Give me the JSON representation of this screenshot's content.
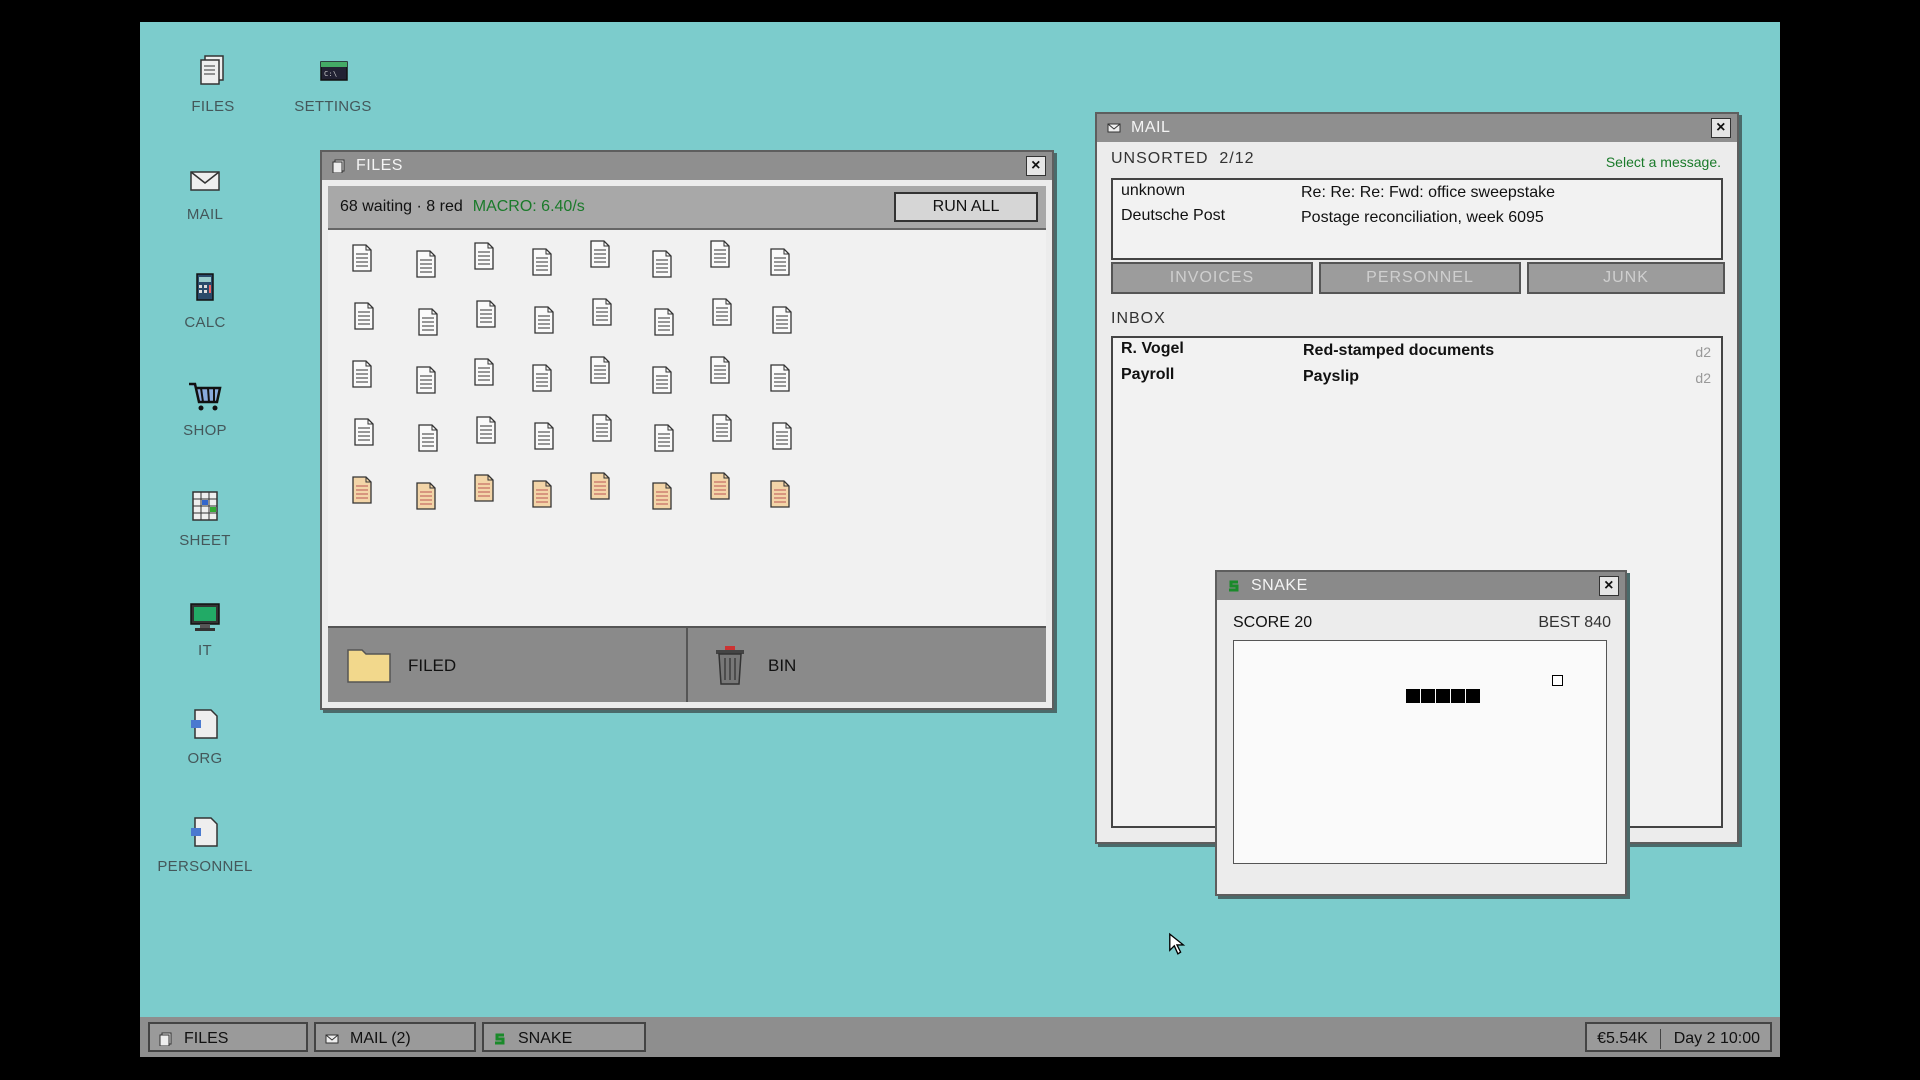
{
  "desktop": {
    "icons": [
      {
        "label": "FILES"
      },
      {
        "label": "SETTINGS"
      },
      {
        "label": "MAIL"
      },
      {
        "label": "CALC"
      },
      {
        "label": "SHOP"
      },
      {
        "label": "SHEET"
      },
      {
        "label": "IT"
      },
      {
        "label": "ORG"
      },
      {
        "label": "PERSONNEL"
      }
    ]
  },
  "files_window": {
    "title": "FILES",
    "status": "68 waiting · 8 red",
    "macro": "MACRO: 6.40/s",
    "run_all": "RUN ALL",
    "filed": "FILED",
    "bin": "BIN"
  },
  "mail_window": {
    "title": "MAIL",
    "unsorted_label": "UNSORTED",
    "unsorted_count": "2/12",
    "hint": "Select a message.",
    "unsorted": [
      {
        "from": "unknown",
        "subject": "Re: Re: Re: Fwd: office sweepstake"
      },
      {
        "from": "Deutsche Post",
        "subject": "Postage reconciliation, week 6095"
      }
    ],
    "tabs": [
      "INVOICES",
      "PERSONNEL",
      "JUNK"
    ],
    "inbox_label": "INBOX",
    "inbox": [
      {
        "from": "R. Vogel",
        "subject": "Red-stamped documents",
        "day": "d2"
      },
      {
        "from": "Payroll",
        "subject": "Payslip",
        "day": "d2"
      }
    ]
  },
  "snake_window": {
    "title": "SNAKE",
    "score": "SCORE 20",
    "best": "BEST 840"
  },
  "taskbar": {
    "items": [
      "FILES",
      "MAIL (2)",
      "SNAKE"
    ],
    "money": "€5.54K",
    "time": "Day 2 10:00"
  },
  "colors": {
    "desktop": "#7ccccc",
    "window_title": "#8f8f8f",
    "macro_green": "#1a7a2a",
    "red_doc": "#f3d5a8"
  }
}
